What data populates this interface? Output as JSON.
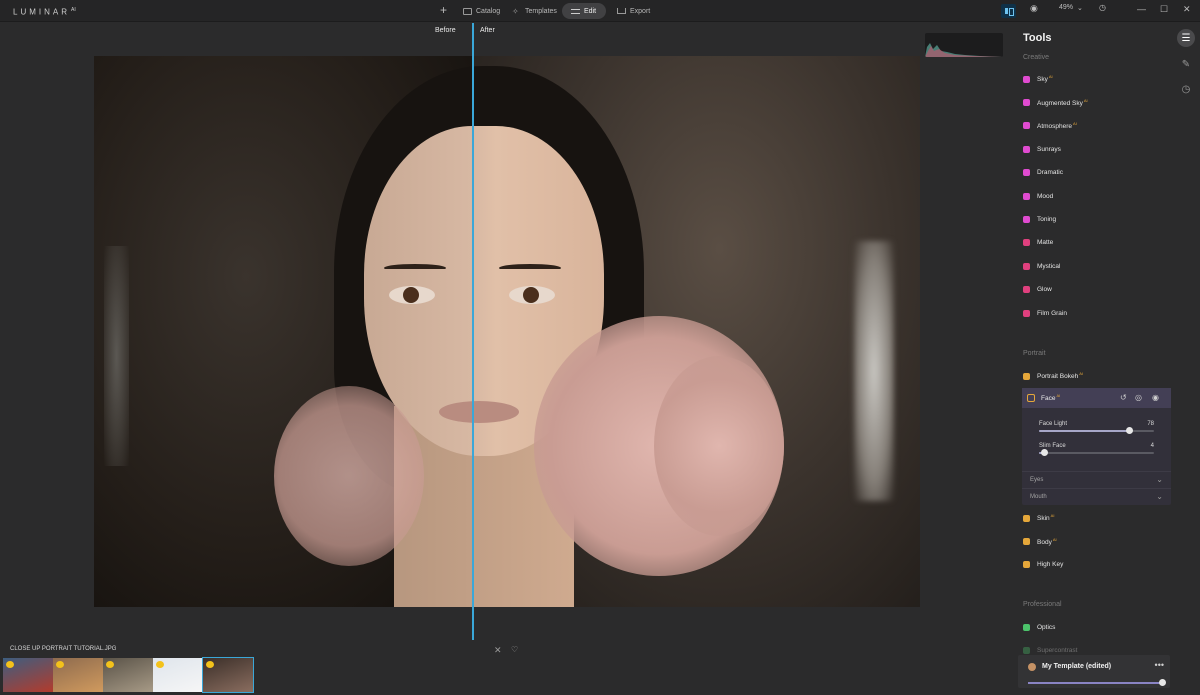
{
  "app": {
    "logo": "LUMINAR",
    "version": "AI"
  },
  "nav": {
    "catalog": "Catalog",
    "templates": "Templates",
    "edit": "Edit",
    "export": "Export"
  },
  "topright": {
    "zoom": "49%",
    "chevron": "⌄"
  },
  "canvas": {
    "before_label": "Before",
    "after_label": "After"
  },
  "filmstrip": {
    "filename": "CLOSE UP PORTRAIT TUTORIAL.JPG",
    "thumbnails": [
      {
        "colors": [
          "#3d5e80",
          "#b33b2c"
        ]
      },
      {
        "colors": [
          "#8e6b4e",
          "#d09a5e"
        ]
      },
      {
        "colors": [
          "#5a5348",
          "#a79a86"
        ]
      },
      {
        "colors": [
          "#dfe5ec",
          "#f6f6f6"
        ]
      },
      {
        "colors": [
          "#3b2f29",
          "#8a6d5f"
        ]
      }
    ]
  },
  "panel": {
    "title": "Tools",
    "sections": {
      "creative": "Creative",
      "portrait": "Portrait",
      "professional": "Professional"
    },
    "creative_tools": [
      {
        "label": "Sky",
        "ai": "AI",
        "color": "#e04bd0"
      },
      {
        "label": "Augmented Sky",
        "ai": "AI",
        "color": "#e04bd0"
      },
      {
        "label": "Atmosphere",
        "ai": "AI",
        "color": "#e04bd0"
      },
      {
        "label": "Sunrays",
        "ai": "",
        "color": "#e04bd0"
      },
      {
        "label": "Dramatic",
        "ai": "",
        "color": "#e04bd0"
      },
      {
        "label": "Mood",
        "ai": "",
        "color": "#e04bd0"
      },
      {
        "label": "Toning",
        "ai": "",
        "color": "#e04bd0"
      },
      {
        "label": "Matte",
        "ai": "",
        "color": "#e0407e"
      },
      {
        "label": "Mystical",
        "ai": "",
        "color": "#e0407e"
      },
      {
        "label": "Glow",
        "ai": "",
        "color": "#e0407e"
      },
      {
        "label": "Film Grain",
        "ai": "",
        "color": "#e0407e"
      }
    ],
    "portrait_tools": [
      {
        "label": "Portrait Bokeh",
        "ai": "AI",
        "color": "#e5a73a"
      },
      {
        "label": "Face",
        "ai": "AI",
        "color": "#e5a73a"
      },
      {
        "label": "Skin",
        "ai": "AI",
        "color": "#e5a73a"
      },
      {
        "label": "Body",
        "ai": "AI",
        "color": "#e5a73a"
      },
      {
        "label": "High Key",
        "ai": "",
        "color": "#e5a73a"
      }
    ],
    "face": {
      "face_light_label": "Face Light",
      "face_light_value": "78",
      "face_light_fraction": 0.78,
      "slim_face_label": "Slim Face",
      "slim_face_value": "4",
      "slim_face_fraction": 0.04,
      "eyes": "Eyes",
      "mouth": "Mouth"
    },
    "professional_tools": [
      {
        "label": "Optics",
        "ai": "",
        "color": "#4cc36b"
      },
      {
        "label": "Supercontrast",
        "ai": "",
        "color": "#4cc36b"
      }
    ],
    "template": {
      "name": "My Template (edited)",
      "more": "•••",
      "amount_fraction": 1.0
    }
  }
}
